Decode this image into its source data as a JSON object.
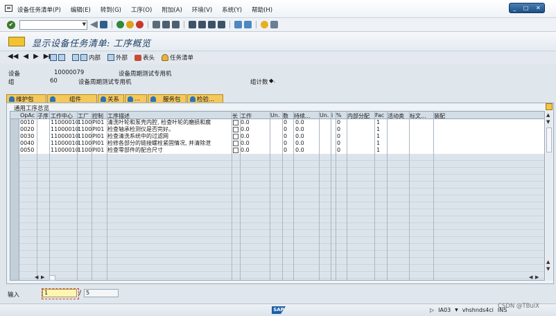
{
  "menu": [
    "设备任务清单(P)",
    "编辑(E)",
    "转到(G)",
    "工序(O)",
    "附加(A)",
    "环境(V)",
    "系统(Y)",
    "帮助(H)"
  ],
  "window_controls": [
    "_",
    "□",
    "✕"
  ],
  "command_field": {
    "value": ""
  },
  "title": "显示设备任务清单: 工序概览",
  "app_toolbar": {
    "nav": [
      "◀◀",
      "◀",
      "▶",
      "▶▶"
    ],
    "internal": "内部",
    "external": "外部",
    "header": "表头",
    "task_list": "任务清单"
  },
  "header": {
    "equipment_label": "设备",
    "equipment_value": "10000079",
    "equipment_desc": "设备周期测试专用机",
    "group_label": "组",
    "group_value": "60",
    "group_desc": "设备周期测试专用机",
    "counter_label": "组计数"
  },
  "tabs": [
    "维护包",
    "组件",
    "关系",
    "...",
    "服务包",
    "检验..."
  ],
  "panel_title": "通用工序总览",
  "columns": [
    "OpAc",
    "子序",
    "工作中心",
    "工厂",
    "控制",
    "工序描述",
    "长",
    "工作",
    "Un.",
    "数",
    "持续...",
    "Un.",
    "i",
    "%",
    "内部分配",
    "Fac",
    "活动类",
    "标文...",
    "装配"
  ],
  "rows": [
    {
      "op": "0010",
      "wc": "11000010",
      "plant": "1100",
      "ctrl": "PI01",
      "desc": "清洗叶轮和泵壳内腔, 检查叶轮的磨损和腐",
      "work": "0.0",
      "num": "0",
      "dur": "0.0",
      "pct": "0",
      "fac": "1"
    },
    {
      "op": "0020",
      "wc": "11000010",
      "plant": "1100",
      "ctrl": "PI01",
      "desc": "检查轴承检测仪是否完好。",
      "work": "0.0",
      "num": "0",
      "dur": "0.0",
      "pct": "0",
      "fac": "1"
    },
    {
      "op": "0030",
      "wc": "11000010",
      "plant": "1100",
      "ctrl": "PI01",
      "desc": "检查清洗系统中的过滤网",
      "work": "0.0",
      "num": "0",
      "dur": "0.0",
      "pct": "0",
      "fac": "1"
    },
    {
      "op": "0040",
      "wc": "11000010",
      "plant": "1100",
      "ctrl": "PI01",
      "desc": "检修各部分的链接螺栓紧固情况, 并清除泄",
      "work": "0.0",
      "num": "0",
      "dur": "0.0",
      "pct": "0",
      "fac": "1"
    },
    {
      "op": "0050",
      "wc": "11000010",
      "plant": "1100",
      "ctrl": "PI01",
      "desc": "检查零部件的配合尺寸",
      "work": "0.0",
      "num": "0",
      "dur": "0.0",
      "pct": "0",
      "fac": "1"
    }
  ],
  "input_line": {
    "label": "输入",
    "current": "1",
    "total": "5"
  },
  "status": {
    "sap": "SAP",
    "transaction": "IA03",
    "server": "vhshnds4ci",
    "mode": "INS"
  },
  "watermark": "CSDN @TBuiX"
}
